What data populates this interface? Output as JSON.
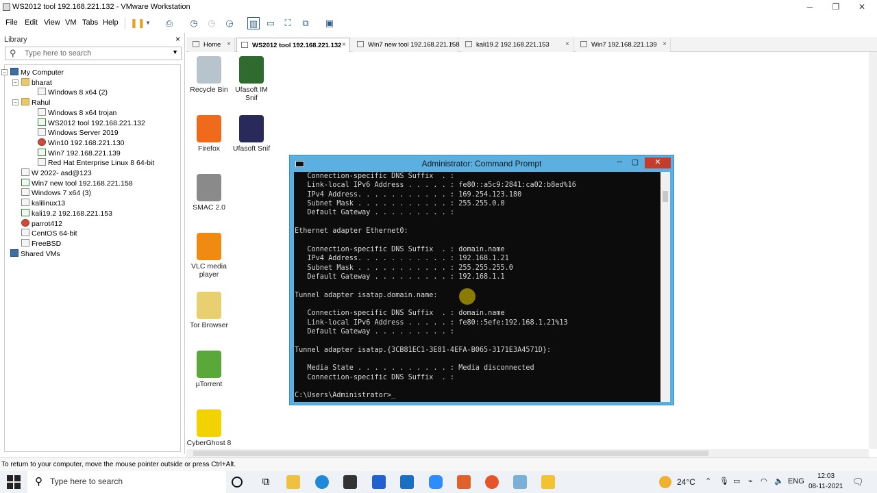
{
  "window": {
    "title": "WS2012 tool 192.168.221.132 - VMware Workstation",
    "minimize": "─",
    "maximize": "❐",
    "close": "✕"
  },
  "menu": [
    "File",
    "Edit",
    "View",
    "VM",
    "Tabs",
    "Help"
  ],
  "library": {
    "title": "Library",
    "close": "×",
    "search_placeholder": "Type here to search",
    "tree": [
      {
        "label": "My Computer",
        "level": 0,
        "kind": "pc",
        "expander": "−"
      },
      {
        "label": "bharat",
        "level": 1,
        "kind": "folder",
        "expander": "−"
      },
      {
        "label": "Windows 8 x64 (2)",
        "level": 2,
        "kind": "vm"
      },
      {
        "label": "Rahul",
        "level": 1,
        "kind": "folder",
        "expander": "−"
      },
      {
        "label": "Windows 8 x64 trojan",
        "level": 2,
        "kind": "vm"
      },
      {
        "label": "WS2012 tool 192.168.221.132",
        "level": 2,
        "kind": "run",
        "selected": true
      },
      {
        "label": "Windows Server 2019",
        "level": 2,
        "kind": "vm"
      },
      {
        "label": "Win10 192.168.221.130",
        "level": 2,
        "kind": "err"
      },
      {
        "label": "Win7 192.168.221.139",
        "level": 2,
        "kind": "run"
      },
      {
        "label": "Red Hat Enterprise Linux 8 64-bit",
        "level": 2,
        "kind": "vm"
      },
      {
        "label": "W 2022- asd@123",
        "level": 1,
        "kind": "vm"
      },
      {
        "label": "Win7  new tool 192.168.221.158",
        "level": 1,
        "kind": "run"
      },
      {
        "label": "Windows 7 x64 (3)",
        "level": 1,
        "kind": "vm"
      },
      {
        "label": "kalilinux13",
        "level": 1,
        "kind": "vm"
      },
      {
        "label": "kali19.2 192.168.221.153",
        "level": 1,
        "kind": "run"
      },
      {
        "label": "parrot412",
        "level": 1,
        "kind": "err"
      },
      {
        "label": "CentOS 64-bit",
        "level": 1,
        "kind": "vm"
      },
      {
        "label": "FreeBSD",
        "level": 1,
        "kind": "vm"
      },
      {
        "label": "Shared VMs",
        "level": 0,
        "kind": "pc"
      }
    ]
  },
  "tabs": [
    {
      "label": "Home",
      "x": "×"
    },
    {
      "label": "WS2012 tool 192.168.221.132",
      "x": "×",
      "active": true
    },
    {
      "label": "Win7  new tool 192.168.221.158",
      "x": "×"
    },
    {
      "label": "kali19.2 192.168.221.153",
      "x": "×"
    },
    {
      "label": "Win7 192.168.221.139",
      "x": "×"
    }
  ],
  "desktop_icons": [
    {
      "label": "Recycle Bin",
      "color": "#b8c4cc"
    },
    {
      "label": "Ufasoft IM Snif",
      "color": "#2f6b2f"
    },
    {
      "label": "Firefox",
      "color": "#f06a1c"
    },
    {
      "label": "Ufasoft Snif",
      "color": "#2a2a5a"
    },
    {
      "label": "SMAC 2.0",
      "color": "#8a8a8a"
    },
    {
      "label": "VLC media player",
      "color": "#f08a10"
    },
    {
      "label": "Tor Browser",
      "color": "#e8d070"
    },
    {
      "label": "µTorrent",
      "color": "#5aa83a"
    },
    {
      "label": "CyberGhost 8",
      "color": "#f2d200"
    }
  ],
  "cmd": {
    "title": "Administrator: Command Prompt",
    "lines": [
      "   Connection-specific DNS Suffix  . :",
      "   Link-local IPv6 Address . . . . . : fe80::a5c9:2841:ca02:b8ed%16",
      "   IPv4 Address. . . . . . . . . . . : 169.254.123.180",
      "   Subnet Mask . . . . . . . . . . . : 255.255.0.0",
      "   Default Gateway . . . . . . . . . :",
      "",
      "Ethernet adapter Ethernet0:",
      "",
      "   Connection-specific DNS Suffix  . : domain.name",
      "   IPv4 Address. . . . . . . . . . . : 192.168.1.21",
      "   Subnet Mask . . . . . . . . . . . : 255.255.255.0",
      "   Default Gateway . . . . . . . . . : 192.168.1.1",
      "",
      "Tunnel adapter isatap.domain.name:",
      "",
      "   Connection-specific DNS Suffix  . : domain.name",
      "   Link-local IPv6 Address . . . . . : fe80::5efe:192.168.1.21%13",
      "   Default Gateway . . . . . . . . . :",
      "",
      "Tunnel adapter isatap.{3CB81EC1-3E81-4EFA-B065-3171E3A4571D}:",
      "",
      "   Media State . . . . . . . . . . . : Media disconnected",
      "   Connection-specific DNS Suffix  . :",
      "",
      "C:\\Users\\Administrator>_"
    ]
  },
  "status": {
    "message": "To return to your computer, move the mouse pointer outside or press Ctrl+Alt."
  },
  "taskbar": {
    "search_placeholder": "Type here to search",
    "temperature": "24°C",
    "language": "ENG",
    "time": "12:03",
    "date": "08-11-2021"
  }
}
